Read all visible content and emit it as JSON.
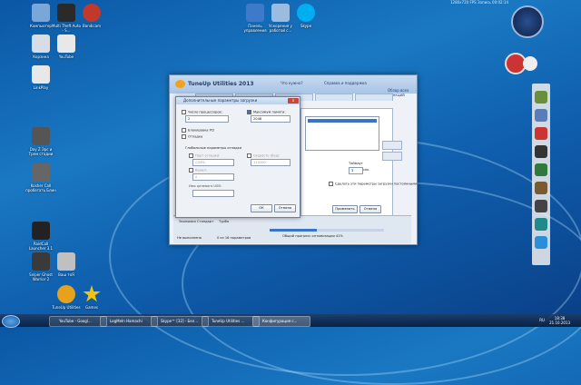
{
  "desktop_icons": [
    {
      "label": "Компьютер",
      "color": "#7aa7d8"
    },
    {
      "label": "Multi Theft Auto - S...",
      "color": "#2a2a2a"
    },
    {
      "label": "Bandicam",
      "color": "#c0392b"
    },
    {
      "label": "Корзина",
      "color": "#d6dde6"
    },
    {
      "label": "YouTube",
      "color": "#e8e8e8"
    },
    {
      "label": "LinkPlay",
      "color": "#e8e8e8"
    },
    {
      "label": "Day Z Эрс и Трем стадии",
      "color": "#555"
    },
    {
      "label": "Kosher Call пробегать Блин",
      "color": "#666"
    },
    {
      "label": "RaidCall Launcher 3.1",
      "color": "#222"
    },
    {
      "label": "Sniper Ghost Warrior 2",
      "color": "#3a3a3a"
    },
    {
      "label": "Ваш тоЯ",
      "color": "#c0c0c0"
    },
    {
      "label": "TuneUp Utilities",
      "color": "#e6a21c"
    },
    {
      "label": "Games",
      "color": "#f4c20d"
    },
    {
      "label": "Панель управления",
      "color": "#3d7ac9"
    },
    {
      "label": "Ускорения у работой с...",
      "color": "#9bbbe0"
    },
    {
      "label": "Skype",
      "color": "#00aff0"
    }
  ],
  "top_tray": {
    "text": "1280x720 FPS  Запись 00:02:14"
  },
  "tuneup": {
    "title": "TuneUp Utilities 2013",
    "nav": [
      "Что нужно?",
      "Справка и поддержка",
      "Обзор всех функций"
    ]
  },
  "dialog": {
    "title": "Дополнительные параметры загрузки",
    "close": "x",
    "cpu_count_label": "Число процессоров:",
    "cpu_count_value": "2",
    "max_memory_label": "Максимум памяти:",
    "max_memory_value": "2048",
    "pci_lock_label": "Блокировка PCI",
    "debug_label": "Отладка",
    "global_debug": "Глобальные параметры отладки",
    "debug_port_label": "Порт отладки:",
    "debug_port_value": "COM1:",
    "baud_label": "Скорость (бод):",
    "baud_value": "115200",
    "channel_label": "Канал:",
    "channel_value": "0",
    "usb_label": "Имя целевого USB:",
    "ok": "ОК",
    "cancel": "Отмена"
  },
  "main_panel": {
    "timeout_label": "Таймаут",
    "timeout_value": "3",
    "sec": "сек.",
    "persist": "Сделать эти параметры загрузки постоянными",
    "apply": "Применить",
    "cancel": "Отмена",
    "economy": "Экономия",
    "standard": "Стандарт",
    "turbo": "Турбо",
    "not_optimized": "Не выполнено",
    "params": "0 из 16 параметров",
    "progress": "Общий прогресс оптимизации 41%",
    "progress_value": 0.41
  },
  "taskbar": {
    "items": [
      "YouTube - Googl...",
      "LogMeIn Hamachi",
      "Skype™ [32] - Бел...",
      "TuneUp Utilities ...",
      "Конфигурация с..."
    ],
    "lang": "RU",
    "time": "18:38",
    "date": "21.10.2013"
  }
}
